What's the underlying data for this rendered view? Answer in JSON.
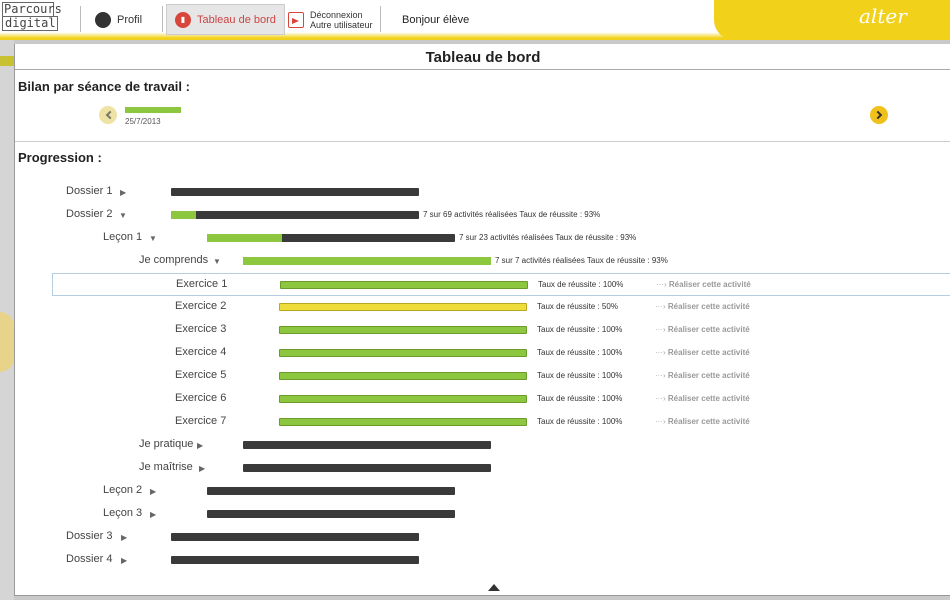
{
  "app": {
    "logo_line1": "Parcours",
    "logo_line2": "digital",
    "brand": "alter"
  },
  "nav": {
    "profil": "Profil",
    "dashboard": "Tableau de bord",
    "logout_line1": "Déconnexion",
    "logout_line2": "Autre utilisateur",
    "greeting": "Bonjour élève"
  },
  "page": {
    "title": "Tableau de bord"
  },
  "sessions": {
    "heading": "Bilan par séance de travail :",
    "items": [
      {
        "date": "25/7/2013"
      }
    ]
  },
  "progression": {
    "heading": "Progression :",
    "action_prefix": "···›",
    "action_label": "Réaliser cette activité",
    "rows": [
      {
        "label": "Dossier 1",
        "expanded": false,
        "progress": 0
      },
      {
        "label": "Dossier 2",
        "expanded": true,
        "progress": 0.101,
        "info": "7 sur 69 activités réalisées  Taux de réussite : 93%"
      },
      {
        "label": "Leçon 1",
        "expanded": true,
        "progress": 0.304,
        "info": "7 sur 23 activités réalisées  Taux de réussite : 93%"
      },
      {
        "label": "Je comprends",
        "expanded": true,
        "progress": 1,
        "info": "7 sur 7 activités réalisées  Taux de réussite : 93%"
      },
      {
        "label": "Exercice 1",
        "success": "Taux de réussite : 100%",
        "status": "green"
      },
      {
        "label": "Exercice 2",
        "success": "Taux de réussite : 50%",
        "status": "yellow"
      },
      {
        "label": "Exercice 3",
        "success": "Taux de réussite : 100%",
        "status": "green"
      },
      {
        "label": "Exercice 4",
        "success": "Taux de réussite : 100%",
        "status": "green"
      },
      {
        "label": "Exercice 5",
        "success": "Taux de réussite : 100%",
        "status": "green"
      },
      {
        "label": "Exercice 6",
        "success": "Taux de réussite : 100%",
        "status": "green"
      },
      {
        "label": "Exercice 7",
        "success": "Taux de réussite : 100%",
        "status": "green"
      },
      {
        "label": "Je pratique",
        "expanded": false,
        "progress": 0
      },
      {
        "label": "Je maîtrise",
        "expanded": false,
        "progress": 0
      },
      {
        "label": "Leçon 2",
        "expanded": false,
        "progress": 0
      },
      {
        "label": "Leçon 3",
        "expanded": false,
        "progress": 0
      },
      {
        "label": "Dossier 3",
        "expanded": false,
        "progress": 0
      },
      {
        "label": "Dossier 4",
        "expanded": false,
        "progress": 0
      }
    ]
  },
  "colors": {
    "accent": "#f2d11b",
    "success_green": "#8dc63f",
    "partial_yellow": "#eedc3a",
    "empty_bar": "#3a3a3a"
  }
}
